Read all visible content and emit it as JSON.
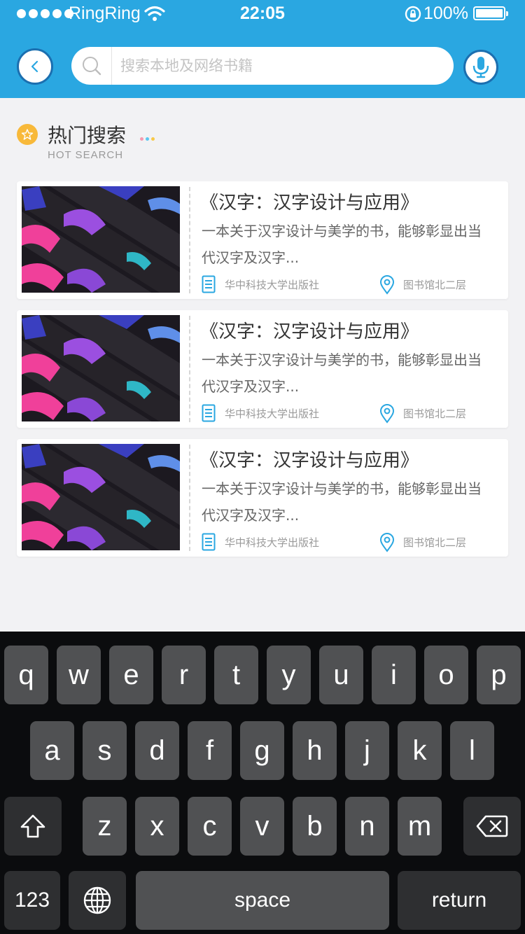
{
  "status_bar": {
    "carrier": "RingRing",
    "time": "22:05",
    "battery_percent": "100%",
    "icons": [
      "signal-dots-icon",
      "wifi-icon",
      "rotation-lock-icon",
      "battery-icon"
    ]
  },
  "search": {
    "placeholder": "搜索本地及网络书籍",
    "value": "",
    "icons": [
      "back-arrow-icon",
      "search-icon",
      "microphone-icon"
    ]
  },
  "section": {
    "title": "热门搜索",
    "subtitle": "HOT SEARCH"
  },
  "books": [
    {
      "title": "《汉字：汉字设计与应用》",
      "description": "一本关于汉字设计与美学的书，能够彰显出当代汉字及汉字...",
      "publisher": "华中科技大学出版社",
      "location": "图书馆北二层"
    },
    {
      "title": "《汉字：汉字设计与应用》",
      "description": "一本关于汉字设计与美学的书，能够彰显出当代汉字及汉字...",
      "publisher": "华中科技大学出版社",
      "location": "图书馆北二层"
    },
    {
      "title": "《汉字：汉字设计与应用》",
      "description": "一本关于汉字设计与美学的书，能够彰显出当代汉字及汉字...",
      "publisher": "华中科技大学出版社",
      "location": "图书馆北二层"
    }
  ],
  "keyboard": {
    "row1": [
      "q",
      "w",
      "e",
      "r",
      "t",
      "y",
      "u",
      "i",
      "o",
      "p"
    ],
    "row2": [
      "a",
      "s",
      "d",
      "f",
      "g",
      "h",
      "j",
      "k",
      "l"
    ],
    "row3": [
      "z",
      "x",
      "c",
      "v",
      "b",
      "n",
      "m"
    ],
    "numbers_label": "123",
    "space_label": "space",
    "return_label": "return"
  },
  "colors": {
    "header": "#2aa7e1",
    "accent_icon": "#2aa7e1",
    "section_badge": "#f8b93a",
    "keyboard_bg": "#0b0c0e",
    "key": "#505153"
  }
}
